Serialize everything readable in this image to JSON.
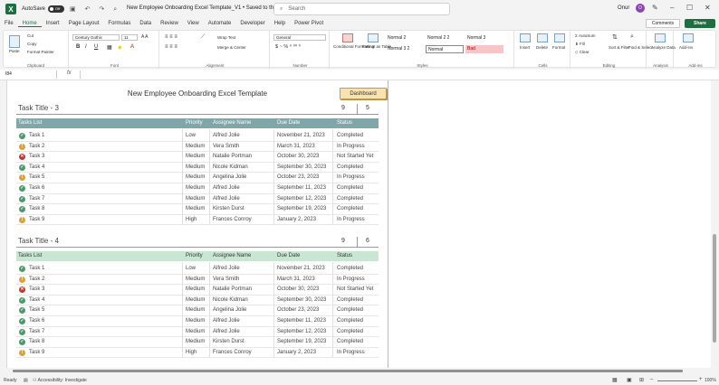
{
  "titlebar": {
    "autosave_label": "AutoSave",
    "autosave_state": "Off",
    "doc_title": "New Employee Onboarding Excel Template_V1 • Saved to this PC",
    "search_placeholder": "Search",
    "user": "Onur",
    "avatar_initial": "O"
  },
  "menu": [
    "File",
    "Home",
    "Insert",
    "Page Layout",
    "Formulas",
    "Data",
    "Review",
    "View",
    "Automate",
    "Developer",
    "Help",
    "Power Pivot"
  ],
  "menu_active": "Home",
  "menu_right": {
    "comments": "Comments",
    "share": "Share"
  },
  "ribbon": {
    "clipboard": {
      "paste": "Paste",
      "cut": "Cut",
      "copy": "Copy",
      "format_painter": "Format Painter",
      "label": "Clipboard"
    },
    "font": {
      "name": "Century Gothic",
      "size": "11",
      "label": "Font"
    },
    "alignment": {
      "wrap": "Wrap Text",
      "merge": "Merge & Center",
      "label": "Alignment"
    },
    "number": {
      "format": "General",
      "label": "Number"
    },
    "styles": {
      "conditional": "Conditional Formatting",
      "format_table": "Format as Table",
      "cells": [
        "Normal 2",
        "Normal 2 2",
        "Normal 3",
        "Normal 3 2",
        "Normal",
        "Bad"
      ],
      "label": "Styles"
    },
    "cells": {
      "insert": "Insert",
      "delete": "Delete",
      "format": "Format",
      "label": "Cells"
    },
    "editing": {
      "autosum": "AutoSum",
      "fill": "Fill",
      "clear": "Clear",
      "sort": "Sort & Filter",
      "find": "Find & Select",
      "label": "Editing"
    },
    "analysis": {
      "analyze": "Analyze Data",
      "label": "Analysis"
    },
    "addins": {
      "label": "Add-ins",
      "addins_btn": "Add-ins"
    }
  },
  "formula_bar": {
    "name_box": "I84",
    "fx": "fx",
    "value": ""
  },
  "sheet": {
    "title": "New Employee Onboarding Excel Template",
    "dashboard_button": "Dashboard",
    "columns": {
      "task": "Tasks List",
      "priority": "Priority",
      "assignee": "Assignee Name",
      "due": "Due Date",
      "status": "Status"
    },
    "sections": [
      {
        "title": "Task Title - 3",
        "count_a": "9",
        "count_b": "5",
        "header_color": "#7fa6a8",
        "tasks": [
          {
            "name": "Task 1",
            "priority": "Low",
            "assignee": "Alfred Jolie",
            "due": "November 21, 2023",
            "status": "Completed",
            "icon": "check"
          },
          {
            "name": "Task 2",
            "priority": "Medium",
            "assignee": "Vera Smith",
            "due": "March 31, 2023",
            "status": "In Progress",
            "icon": "progress"
          },
          {
            "name": "Task 3",
            "priority": "Medium",
            "assignee": "Natalie Portman",
            "due": "October 30, 2023",
            "status": "Not Started Yet",
            "icon": "cross"
          },
          {
            "name": "Task 4",
            "priority": "Medium",
            "assignee": "Nicole Kidman",
            "due": "September 30, 2023",
            "status": "Completed",
            "icon": "check"
          },
          {
            "name": "Task 5",
            "priority": "Medium",
            "assignee": "Angelina Jolie",
            "due": "October 23, 2023",
            "status": "In Progress",
            "icon": "progress"
          },
          {
            "name": "Task 6",
            "priority": "Medium",
            "assignee": "Alfred Jolie",
            "due": "September 11, 2023",
            "status": "Completed",
            "icon": "check"
          },
          {
            "name": "Task 7",
            "priority": "Medium",
            "assignee": "Alfred Jolie",
            "due": "September 12, 2023",
            "status": "Completed",
            "icon": "check"
          },
          {
            "name": "Task 8",
            "priority": "Medium",
            "assignee": "Kirsten Durst",
            "due": "September 19, 2023",
            "status": "Completed",
            "icon": "check"
          },
          {
            "name": "Task 9",
            "priority": "High",
            "assignee": "Frances Conroy",
            "due": "January 2, 2023",
            "status": "In Progress",
            "icon": "progress"
          }
        ]
      },
      {
        "title": "Task Title - 4",
        "count_a": "9",
        "count_b": "6",
        "header_color": "#c9e6d3",
        "tasks": [
          {
            "name": "Task 1",
            "priority": "Low",
            "assignee": "Alfred Jolie",
            "due": "November 21, 2023",
            "status": "Completed",
            "icon": "check"
          },
          {
            "name": "Task 2",
            "priority": "Medium",
            "assignee": "Vera Smith",
            "due": "March 31, 2023",
            "status": "In Progress",
            "icon": "progress"
          },
          {
            "name": "Task 3",
            "priority": "Medium",
            "assignee": "Natalie Portman",
            "due": "October 30, 2023",
            "status": "Not Started Yet",
            "icon": "cross"
          },
          {
            "name": "Task 4",
            "priority": "Medium",
            "assignee": "Nicole Kidman",
            "due": "September 30, 2023",
            "status": "Completed",
            "icon": "check"
          },
          {
            "name": "Task 5",
            "priority": "Medium",
            "assignee": "Angelina Jolie",
            "due": "October 23, 2023",
            "status": "Completed",
            "icon": "check"
          },
          {
            "name": "Task 6",
            "priority": "Medium",
            "assignee": "Alfred Jolie",
            "due": "September 11, 2023",
            "status": "Completed",
            "icon": "check"
          },
          {
            "name": "Task 7",
            "priority": "Medium",
            "assignee": "Alfred Jolie",
            "due": "September 12, 2023",
            "status": "Completed",
            "icon": "check"
          },
          {
            "name": "Task 8",
            "priority": "Medium",
            "assignee": "Kirsten Durst",
            "due": "September 19, 2023",
            "status": "Completed",
            "icon": "check"
          },
          {
            "name": "Task 9",
            "priority": "High",
            "assignee": "Frances Conroy",
            "due": "January 2, 2023",
            "status": "In Progress",
            "icon": "progress"
          }
        ]
      }
    ]
  },
  "status_icon_colors": {
    "check": "#4a9a6a",
    "progress": "#e0a030",
    "cross": "#c0392b"
  },
  "statusbar": {
    "ready": "Ready",
    "accessibility": "Accessibility: Investigate",
    "zoom": "100%"
  }
}
